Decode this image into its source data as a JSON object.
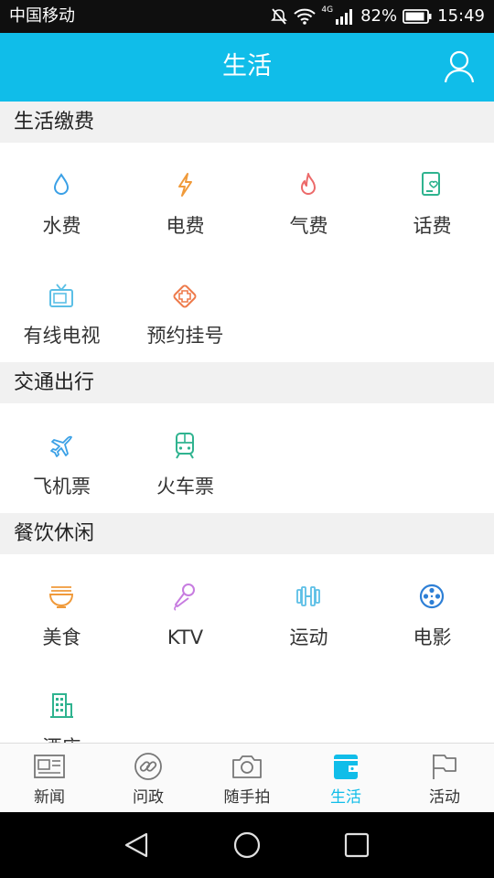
{
  "status": {
    "carrier": "中国移动",
    "network": "4G",
    "battery_percent": "82%",
    "time": "15:49"
  },
  "header": {
    "title": "生活"
  },
  "sections": [
    {
      "title": "生活缴费",
      "items": [
        {
          "label": "水费",
          "icon": "water-drop-icon"
        },
        {
          "label": "电费",
          "icon": "lightning-icon"
        },
        {
          "label": "气费",
          "icon": "flame-icon"
        },
        {
          "label": "话费",
          "icon": "phone-bill-icon"
        },
        {
          "label": "有线电视",
          "icon": "tv-icon"
        },
        {
          "label": "预约挂号",
          "icon": "medical-cross-icon"
        }
      ]
    },
    {
      "title": "交通出行",
      "items": [
        {
          "label": "飞机票",
          "icon": "airplane-icon"
        },
        {
          "label": "火车票",
          "icon": "train-icon"
        }
      ]
    },
    {
      "title": "餐饮休闲",
      "items": [
        {
          "label": "美食",
          "icon": "noodle-bowl-icon"
        },
        {
          "label": "KTV",
          "icon": "microphone-icon"
        },
        {
          "label": "运动",
          "icon": "dumbbell-icon"
        },
        {
          "label": "电影",
          "icon": "film-reel-icon"
        },
        {
          "label": "酒店",
          "icon": "hotel-building-icon"
        }
      ]
    }
  ],
  "bottom_nav": [
    {
      "label": "新闻",
      "icon": "newspaper-icon"
    },
    {
      "label": "问政",
      "icon": "link-icon"
    },
    {
      "label": "随手拍",
      "icon": "camera-icon"
    },
    {
      "label": "生活",
      "icon": "wallet-icon",
      "active": true
    },
    {
      "label": "活动",
      "icon": "flag-icon"
    }
  ],
  "colors": {
    "primary": "#10bde9",
    "section_bg": "#f1f1f1"
  }
}
